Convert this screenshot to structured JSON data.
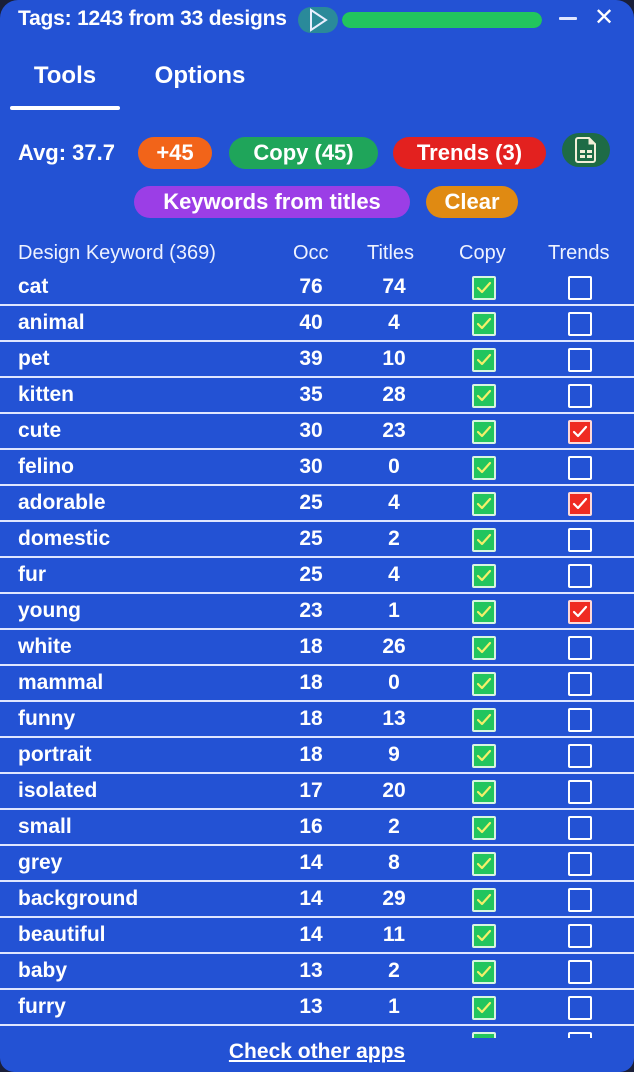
{
  "titlebar": {
    "title": "Tags: 1243 from 33 designs",
    "play_icon": "play-icon",
    "progress_percent": 100,
    "minimize_icon": "minimize-icon",
    "close_label": "✕"
  },
  "tabs": [
    {
      "label": "Tools",
      "active": true
    },
    {
      "label": "Options",
      "active": false
    }
  ],
  "toolbar": {
    "avg_label": "Avg: 37.7",
    "plus_label": "+45",
    "copy_label": "Copy (45)",
    "trends_label": "Trends (3)",
    "sheet_icon": "spreadsheet-icon",
    "keywords_label": "Keywords from titles",
    "clear_label": "Clear"
  },
  "colors": {
    "background": "#2352d4",
    "plus": "#f26419",
    "copy": "#1fa55a",
    "trends": "#e3211f",
    "sheet": "#1e6b46",
    "keywords": "#9b3ee6",
    "clear": "#e08a12",
    "progress": "#22c55e"
  },
  "table": {
    "headers": {
      "keyword": "Design Keyword (369)",
      "occ": "Occ",
      "titles": "Titles",
      "copy": "Copy",
      "trends": "Trends"
    },
    "rows": [
      {
        "keyword": "cat",
        "occ": "76",
        "titles": "74",
        "copy": true,
        "trends": false
      },
      {
        "keyword": "animal",
        "occ": "40",
        "titles": "4",
        "copy": true,
        "trends": false
      },
      {
        "keyword": "pet",
        "occ": "39",
        "titles": "10",
        "copy": true,
        "trends": false
      },
      {
        "keyword": "kitten",
        "occ": "35",
        "titles": "28",
        "copy": true,
        "trends": false
      },
      {
        "keyword": "cute",
        "occ": "30",
        "titles": "23",
        "copy": true,
        "trends": true
      },
      {
        "keyword": "felino",
        "occ": "30",
        "titles": "0",
        "copy": true,
        "trends": false
      },
      {
        "keyword": "adorable",
        "occ": "25",
        "titles": "4",
        "copy": true,
        "trends": true
      },
      {
        "keyword": "domestic",
        "occ": "25",
        "titles": "2",
        "copy": true,
        "trends": false
      },
      {
        "keyword": "fur",
        "occ": "25",
        "titles": "4",
        "copy": true,
        "trends": false
      },
      {
        "keyword": "young",
        "occ": "23",
        "titles": "1",
        "copy": true,
        "trends": true
      },
      {
        "keyword": "white",
        "occ": "18",
        "titles": "26",
        "copy": true,
        "trends": false
      },
      {
        "keyword": "mammal",
        "occ": "18",
        "titles": "0",
        "copy": true,
        "trends": false
      },
      {
        "keyword": "funny",
        "occ": "18",
        "titles": "13",
        "copy": true,
        "trends": false
      },
      {
        "keyword": "portrait",
        "occ": "18",
        "titles": "9",
        "copy": true,
        "trends": false
      },
      {
        "keyword": "isolated",
        "occ": "17",
        "titles": "20",
        "copy": true,
        "trends": false
      },
      {
        "keyword": "small",
        "occ": "16",
        "titles": "2",
        "copy": true,
        "trends": false
      },
      {
        "keyword": "grey",
        "occ": "14",
        "titles": "8",
        "copy": true,
        "trends": false
      },
      {
        "keyword": "background",
        "occ": "14",
        "titles": "29",
        "copy": true,
        "trends": false
      },
      {
        "keyword": "beautiful",
        "occ": "14",
        "titles": "11",
        "copy": true,
        "trends": false
      },
      {
        "keyword": "baby",
        "occ": "13",
        "titles": "2",
        "copy": true,
        "trends": false
      },
      {
        "keyword": "furry",
        "occ": "13",
        "titles": "1",
        "copy": true,
        "trends": false
      },
      {
        "keyword": "",
        "occ": "",
        "titles": "",
        "copy": true,
        "trends": false
      }
    ]
  },
  "footer": {
    "link_label": "Check other apps"
  }
}
